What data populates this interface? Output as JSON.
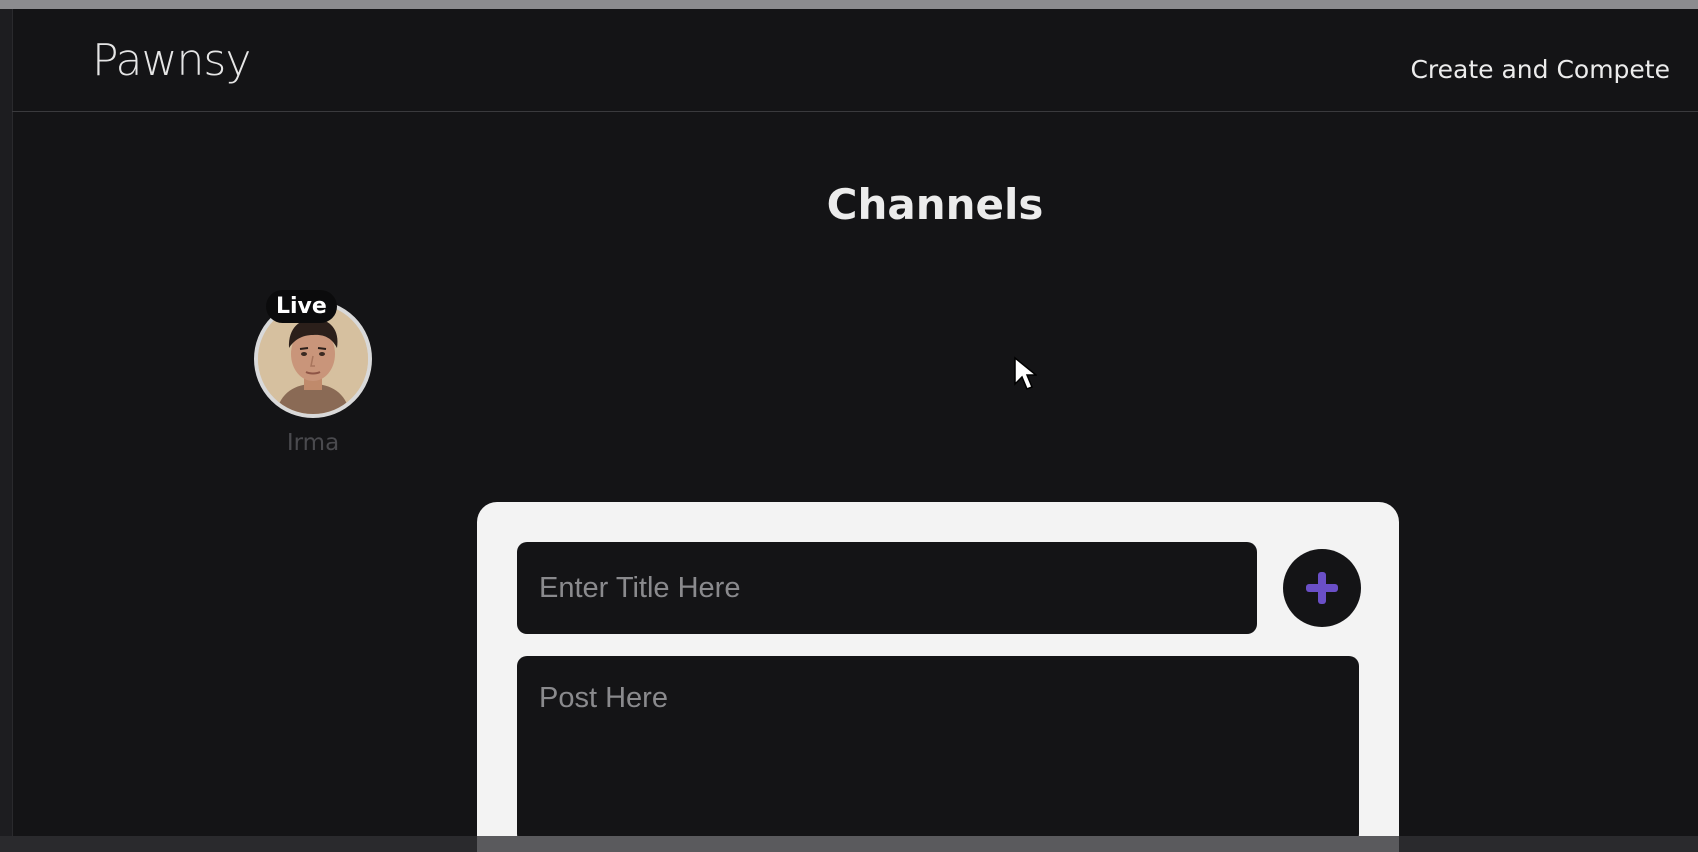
{
  "app": {
    "brand": "Pawnsy",
    "nav_link": "Create and Compete"
  },
  "main": {
    "title": "Channels"
  },
  "channels": [
    {
      "name": "Irma",
      "badge": "Live"
    }
  ],
  "composer": {
    "title_placeholder": "Enter Title Here",
    "post_placeholder": "Post Here",
    "add_icon": "plus-icon",
    "accent_color": "#6a4fc7"
  }
}
